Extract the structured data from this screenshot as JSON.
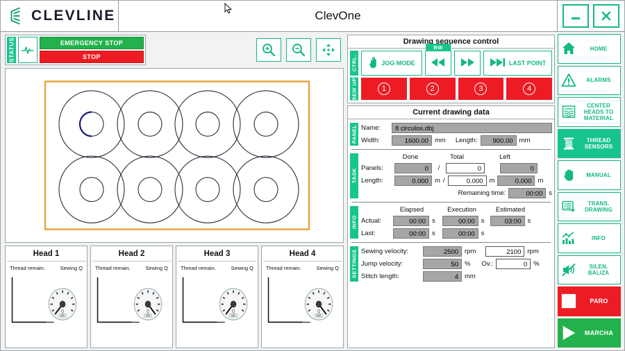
{
  "window": {
    "brand": "CLEVLINE",
    "title": "ClevOne",
    "minimize_label": "minimize",
    "close_label": "close"
  },
  "status": {
    "tab": "STATUS",
    "heart_icon": "heartbeat-icon",
    "emergency_stop": "EMERGENCY STOP",
    "stop": "STOP"
  },
  "toolbar": {
    "zoom_in": "zoom-in-icon",
    "zoom_out": "zoom-out-icon",
    "fit": "fit-to-screen-icon"
  },
  "sequence": {
    "title": "Drawing sequence control",
    "ctrl_tab": "CTRL.",
    "sewup_tab": "SEW UP",
    "bw_tag": "BW",
    "jog_mode": "JOG MODE",
    "rewind": "rewind-icon",
    "forward": "fast-forward-icon",
    "last_point": "LAST POINT",
    "sew_buttons": [
      "1",
      "2",
      "3",
      "4"
    ]
  },
  "drawing_data": {
    "title": "Current drawing data",
    "panel": {
      "tab": "PANEL",
      "name_label": "Name:",
      "name_value": "8 circulos.dbj",
      "width_label": "Width:",
      "width_value": "1600.00",
      "width_unit": "mm",
      "length_label": "Length:",
      "length_value": "900.00",
      "length_unit": "mm"
    },
    "task": {
      "tab": "TASK",
      "col_done": "Done",
      "col_total": "Total",
      "col_left": "Left",
      "panels_label": "Panels:",
      "panels_done": "0",
      "panels_total": "0",
      "panels_left": "0",
      "length_label": "Length:",
      "length_done": "0.000",
      "length_done_unit": "m",
      "length_total": "0.000",
      "length_total_unit": "m",
      "length_left": "0.000",
      "length_left_unit": "m",
      "separator": "/",
      "remaining_label": "Remaining time:",
      "remaining_value": "00:00",
      "remaining_unit": "s"
    },
    "info": {
      "tab": "INFO",
      "col_elapsed": "Elapsed",
      "col_execution": "Execution",
      "col_estimated": "Estimated",
      "actual_label": "Actual:",
      "actual_elapsed": "00:00",
      "actual_execution": "00:00",
      "actual_estimated": "03:00",
      "last_label": "Last:",
      "last_elapsed": "00:00",
      "last_execution": "00:00",
      "unit": "s"
    },
    "settings": {
      "tab": "SETTINGS",
      "sewing_label": "Sewing velocity:",
      "sewing_value": "2500",
      "sewing_unit": "rpm",
      "sewing_target": "2100",
      "sewing_target_unit": "rpm",
      "jump_label": "Jump velocity:",
      "jump_value": "50",
      "jump_unit": "%",
      "ov_label": "Ov.:",
      "ov_value": "0",
      "ov_unit": "%",
      "stitch_label": "Stitch length:",
      "stitch_value": "4",
      "stitch_unit": "mm"
    }
  },
  "heads": [
    {
      "title": "Head 1",
      "thread_label": "Thread remain.",
      "sewing_label": "Sewing Q",
      "needle_angle": -125,
      "gauge_value": "000"
    },
    {
      "title": "Head 2",
      "thread_label": "Thread remain.",
      "sewing_label": "Sewing Q",
      "needle_angle": -55,
      "gauge_value": "000"
    },
    {
      "title": "Head 3",
      "thread_label": "Thread remain.",
      "sewing_label": "Sewing Q",
      "needle_angle": -125,
      "gauge_value": "000"
    },
    {
      "title": "Head 4",
      "thread_label": "Thread remain.",
      "sewing_label": "Sewing Q",
      "needle_angle": -55,
      "gauge_value": "000"
    }
  ],
  "sidebar": [
    {
      "label": "HOME",
      "icon": "home-icon",
      "active": false
    },
    {
      "label": "ALARMS",
      "icon": "warning-triangle-icon",
      "active": false
    },
    {
      "label": "CENTER HEADS TO MATERIAL",
      "icon": "fabric-roll-icon",
      "active": false
    },
    {
      "label": "THREAD SENSORS",
      "icon": "thread-spool-icon",
      "active": true
    },
    {
      "label": "MANUAL",
      "icon": "hand-icon",
      "active": false
    },
    {
      "label": "TRANS. DRAWING",
      "icon": "transfer-drawing-icon",
      "active": false
    },
    {
      "label": "INFO",
      "icon": "chart-icon",
      "active": false
    },
    {
      "label": "SILEN. BALIZA",
      "icon": "mute-speaker-icon",
      "active": false
    }
  ],
  "sidebar_actions": {
    "paro": {
      "label": "PARO",
      "icon": "stop-square-icon",
      "color": "#ed1c24"
    },
    "marcha": {
      "label": "MARCHA",
      "icon": "play-triangle-icon",
      "color": "#22b14c"
    }
  },
  "canvas": {
    "frame_color": "#e8a33d",
    "shape_color": "#2b2b3a",
    "highlight_color": "#1a1a7a",
    "rows": 2,
    "cols": 4,
    "outer_radius": 48,
    "inner_radius": 17
  },
  "colors": {
    "accent_green": "#13b886",
    "bright_green": "#18c48d",
    "red": "#ed1c24",
    "run_green": "#22b14c",
    "field_gray": "#a6a6a6"
  }
}
